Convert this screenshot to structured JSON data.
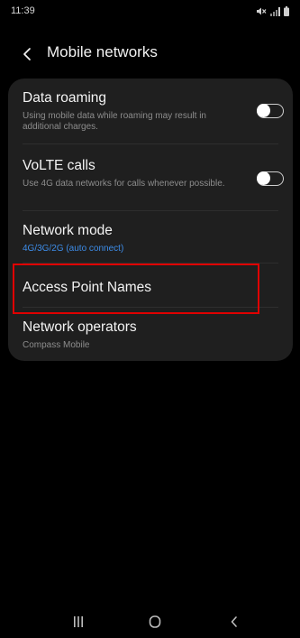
{
  "status_bar": {
    "time": "11:39",
    "icons": [
      "mute-icon",
      "signal-icon",
      "battery-icon"
    ]
  },
  "header": {
    "title": "Mobile networks",
    "back_icon": "chevron-left-icon"
  },
  "settings": [
    {
      "id": "data-roaming",
      "title": "Data roaming",
      "subtitle": "Using mobile data while roaming may result in additional charges.",
      "toggle": "off"
    },
    {
      "id": "volte-calls",
      "title": "VoLTE calls",
      "subtitle": "Use 4G data networks for calls whenever possible.",
      "toggle": "off"
    },
    {
      "id": "network-mode",
      "title": "Network mode",
      "subtitle": "4G/3G/2G (auto connect)"
    },
    {
      "id": "access-point-names",
      "title": "Access Point Names",
      "highlighted": true
    },
    {
      "id": "network-operators",
      "title": "Network operators",
      "subtitle": "Compass Mobile"
    }
  ],
  "nav_bar": {
    "icons": [
      "recents-icon",
      "home-icon",
      "back-icon"
    ]
  },
  "colors": {
    "background": "#000000",
    "card": "#1f1f1f",
    "accent": "#3d8ce8",
    "highlight": "#e00000"
  }
}
